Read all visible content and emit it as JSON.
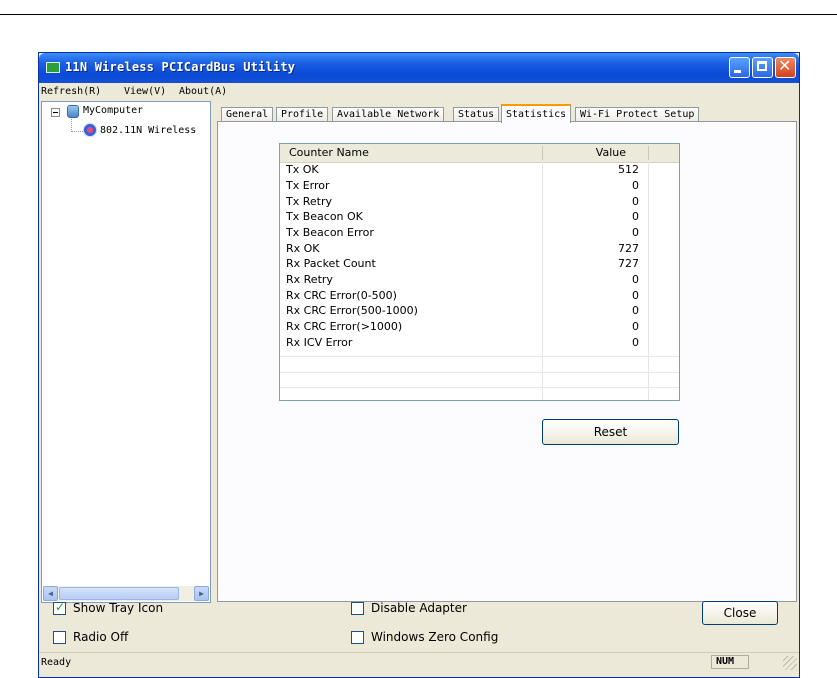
{
  "window": {
    "title": "11N Wireless PCICardBus Utility"
  },
  "menu": [
    "Refresh(R)",
    "View(V)",
    "About(A)"
  ],
  "tree": {
    "root": "MyComputer",
    "child": "802.11N Wireless"
  },
  "tabs": [
    "General",
    "Profile",
    "Available Network",
    "Status",
    "Statistics",
    "Wi-Fi Protect Setup"
  ],
  "active_tab": "Statistics",
  "table": {
    "headers": [
      "Counter Name",
      "Value"
    ],
    "rows": [
      {
        "name": "Tx OK",
        "value": "512"
      },
      {
        "name": "Tx Error",
        "value": "0"
      },
      {
        "name": "Tx Retry",
        "value": "0"
      },
      {
        "name": "Tx Beacon OK",
        "value": "0"
      },
      {
        "name": "Tx Beacon Error",
        "value": "0"
      },
      {
        "name": "Rx OK",
        "value": "727"
      },
      {
        "name": "Rx Packet Count",
        "value": "727"
      },
      {
        "name": "Rx Retry",
        "value": "0"
      },
      {
        "name": "Rx CRC Error(0-500)",
        "value": "0"
      },
      {
        "name": "Rx CRC Error(500-1000)",
        "value": "0"
      },
      {
        "name": "Rx CRC Error(>1000)",
        "value": "0"
      },
      {
        "name": "Rx ICV Error",
        "value": "0"
      }
    ]
  },
  "buttons": {
    "reset": "Reset",
    "close": "Close"
  },
  "checkboxes": {
    "show_tray_icon": {
      "label": "Show Tray Icon",
      "checked": true
    },
    "radio_off": {
      "label": "Radio Off",
      "checked": false
    },
    "disable_adapter": {
      "label": "Disable Adapter",
      "checked": false
    },
    "windows_zero_config": {
      "label": "Windows Zero Config",
      "checked": false
    }
  },
  "status": {
    "text": "Ready",
    "num": "NUM"
  }
}
